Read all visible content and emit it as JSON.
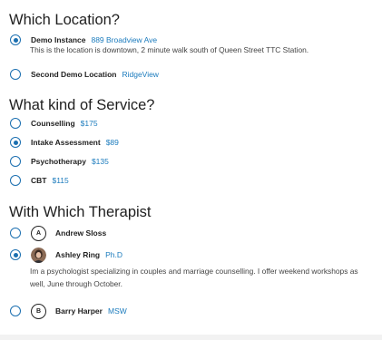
{
  "location": {
    "heading": "Which Location?",
    "options": [
      {
        "label": "Demo Instance",
        "address": "889 Broadview Ave",
        "description": "This is the location is downtown, 2 minute walk south of Queen Street TTC Station.",
        "selected": true
      },
      {
        "label": "Second Demo Location",
        "address": "RidgeView",
        "selected": false
      }
    ]
  },
  "service": {
    "heading": "What kind of Service?",
    "options": [
      {
        "label": "Counselling",
        "price": "$175",
        "selected": false
      },
      {
        "label": "Intake Assessment",
        "price": "$89",
        "selected": true
      },
      {
        "label": "Psychotherapy",
        "price": "$135",
        "selected": false
      },
      {
        "label": "CBT",
        "price": "$115",
        "selected": false
      }
    ]
  },
  "therapist": {
    "heading": "With Which Therapist",
    "options": [
      {
        "initial": "A",
        "name": "Andrew Sloss",
        "credential": "",
        "selected": false
      },
      {
        "initial": "",
        "name": "Ashley Ring",
        "credential": "Ph.D",
        "bio_line1": "Im a psychologist specializing in couples and marriage counselling. I offer weekend workshops as",
        "bio_line2": "well, June through October.",
        "selected": true
      },
      {
        "initial": "B",
        "name": "Barry Harper",
        "credential": "MSW",
        "selected": false
      }
    ]
  },
  "colors": {
    "accent": "#1b6fb0",
    "link": "#1b7bbd",
    "text": "#222222"
  }
}
